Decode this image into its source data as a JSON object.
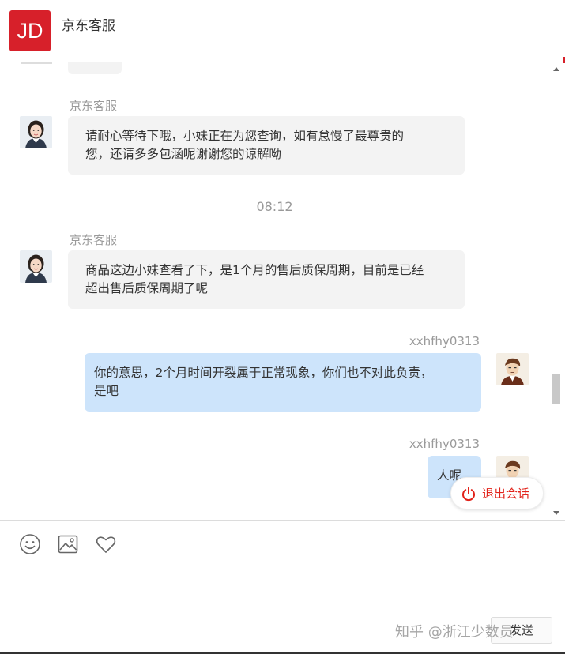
{
  "header": {
    "logo_text": "JD",
    "title": "京东客服"
  },
  "messages": [
    {
      "side": "left",
      "sender": "京东客服",
      "lines": [
        "请耐心等待下哦，小妹正在为您查询，如有怠慢了最尊贵的",
        "您，还请多多包涵呢谢谢您的谅解呦"
      ]
    },
    {
      "time": "08:12"
    },
    {
      "side": "left",
      "sender": "京东客服",
      "lines": [
        "商品这边小妹查看了下，是1个月的售后质保周期，目前是已经",
        "超出售后质保周期了呢"
      ]
    },
    {
      "side": "right",
      "sender": "xxhfhy0313",
      "lines": [
        "你的意思，2个月时间开裂属于正常现象，你们也不对此负责，",
        "是吧"
      ]
    },
    {
      "side": "right",
      "sender": "xxhfhy0313",
      "lines": [
        "人呢"
      ]
    }
  ],
  "exit_button": {
    "label": "退出会话",
    "icon": "power-icon"
  },
  "toolbar": {
    "icons": [
      "emoji-icon",
      "image-icon",
      "heart-icon"
    ]
  },
  "send_button": {
    "label": "发送"
  },
  "watermark": {
    "text": "知乎 @浙江少数员"
  },
  "colors": {
    "brand": "#d7202a",
    "user_bubble": "#cde4fb",
    "agent_bubble": "#f3f3f3",
    "exit_red": "#e2231a"
  }
}
